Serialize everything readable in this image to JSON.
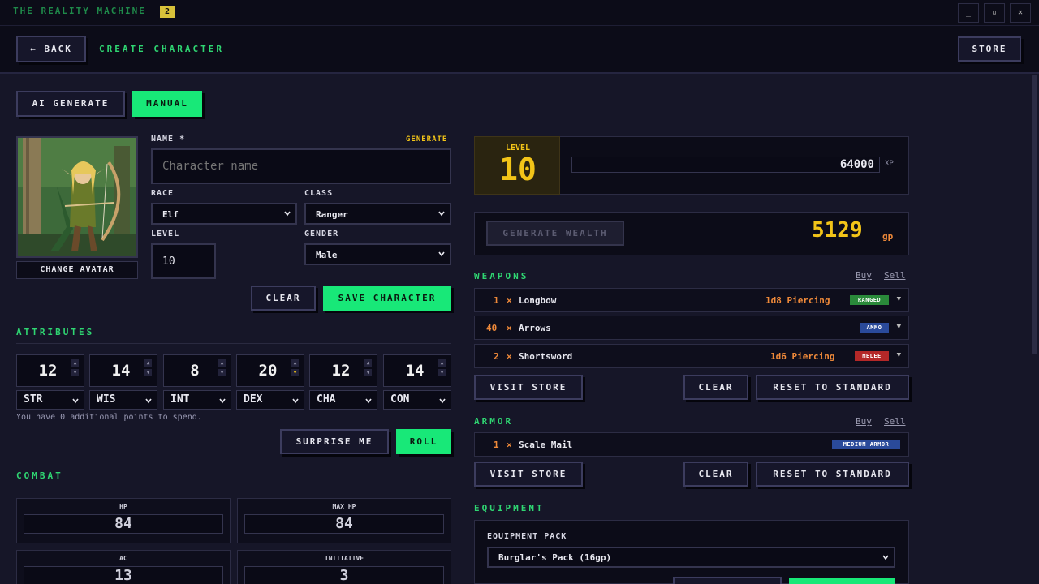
{
  "window": {
    "title": "THE REALITY MACHINE",
    "version": "2",
    "controls": [
      "_",
      "▫",
      "✕"
    ]
  },
  "header": {
    "back_label": "← BACK",
    "page_title": "CREATE CHARACTER",
    "store_label": "STORE"
  },
  "mode_tabs": {
    "ai_generate": "AI GENERATE",
    "manual": "MANUAL",
    "active": "manual"
  },
  "avatar": {
    "change_label": "CHANGE AVATAR"
  },
  "form": {
    "name_label": "NAME *",
    "generate_label": "GENERATE",
    "name_placeholder": "Character name",
    "name_value": "",
    "race_label": "RACE",
    "race_value": "Elf",
    "class_label": "CLASS",
    "class_value": "Ranger",
    "level_label": "LEVEL",
    "level_value": "10",
    "gender_label": "GENDER",
    "gender_value": "Male",
    "clear_label": "CLEAR",
    "save_label": "SAVE CHARACTER"
  },
  "attributes": {
    "title": "ATTRIBUTES",
    "items": [
      {
        "value": "12",
        "stat": "STR"
      },
      {
        "value": "14",
        "stat": "WIS"
      },
      {
        "value": "8",
        "stat": "INT"
      },
      {
        "value": "20",
        "stat": "DEX"
      },
      {
        "value": "12",
        "stat": "CHA"
      },
      {
        "value": "14",
        "stat": "CON"
      }
    ],
    "points_note": "You have 0 additional points to spend.",
    "surprise_label": "SURPRISE ME",
    "roll_label": "ROLL"
  },
  "combat": {
    "title": "COMBAT",
    "hp_label": "HP",
    "hp_value": "84",
    "max_hp_label": "MAX HP",
    "max_hp_value": "84",
    "ac_label": "AC",
    "ac_value": "13",
    "initiative_label": "INITIATIVE",
    "initiative_value": "3"
  },
  "level_panel": {
    "level_label": "LEVEL",
    "level_value": "10",
    "xp_value": "64000",
    "xp_unit": "XP"
  },
  "wealth": {
    "generate_label": "GENERATE WEALTH",
    "amount": "5129",
    "unit": "gp"
  },
  "weapons": {
    "title": "WEAPONS",
    "buy": "Buy",
    "sell": "Sell",
    "items": [
      {
        "qty": "1",
        "times": "×",
        "name": "Longbow",
        "damage": "1d8 Piercing",
        "tag": "RANGED",
        "tag_color": "#2a8a3a"
      },
      {
        "qty": "40",
        "times": "×",
        "name": "Arrows",
        "damage": "",
        "tag": "AMMO",
        "tag_color": "#2a4a9a"
      },
      {
        "qty": "2",
        "times": "×",
        "name": "Shortsword",
        "damage": "1d6 Piercing",
        "tag": "MELEE",
        "tag_color": "#b42828"
      }
    ],
    "visit_store": "VISIT STORE",
    "clear": "CLEAR",
    "reset": "RESET TO STANDARD"
  },
  "armor": {
    "title": "ARMOR",
    "buy": "Buy",
    "sell": "Sell",
    "items": [
      {
        "qty": "1",
        "times": "×",
        "name": "Scale Mail",
        "tag": "MEDIUM ARMOR",
        "tag_color": "#2a4a9a"
      }
    ],
    "visit_store": "VISIT STORE",
    "clear": "CLEAR",
    "reset": "RESET TO STANDARD"
  },
  "equipment": {
    "title": "EQUIPMENT",
    "pack_label": "EQUIPMENT PACK",
    "pack_value": "Burglar's Pack (16gp)"
  },
  "colors": {
    "accent_green": "#18e878",
    "gold": "#f2c418",
    "orange": "#f08a3a",
    "background": "#161628"
  }
}
